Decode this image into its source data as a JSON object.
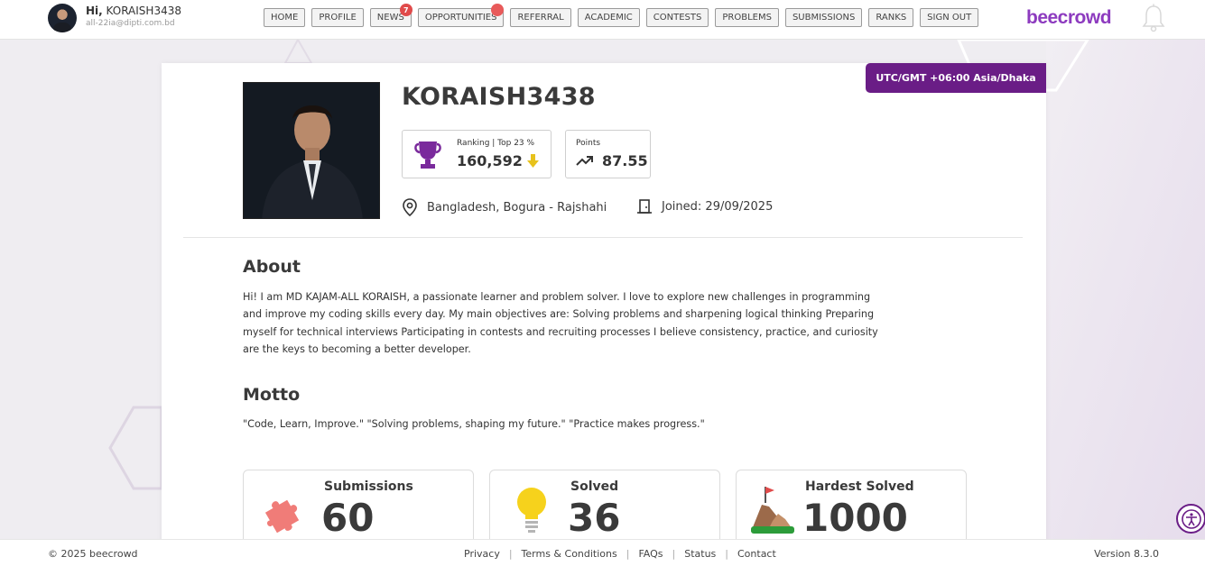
{
  "header": {
    "greeting_prefix": "Hi,",
    "username": "KORAISH3438",
    "email": "all-22ia@dipti.com.bd",
    "brand": "beecrowd",
    "nav": [
      {
        "label": "HOME"
      },
      {
        "label": "PROFILE"
      },
      {
        "label": "NEWS",
        "badge": "7"
      },
      {
        "label": "OPPORTUNITIES",
        "dot": true
      },
      {
        "label": "REFERRAL"
      },
      {
        "label": "ACADEMIC"
      },
      {
        "label": "CONTESTS"
      },
      {
        "label": "PROBLEMS"
      },
      {
        "label": "SUBMISSIONS"
      },
      {
        "label": "RANKS"
      },
      {
        "label": "SIGN OUT"
      }
    ],
    "accent_color": "#8d3bbf"
  },
  "profile": {
    "timezone": "UTC/GMT +06:00 Asia/Dhaka",
    "name": "KORAISH3438",
    "ranking_label": "Ranking | Top 23 %",
    "ranking_value": "160,592",
    "points_label": "Points",
    "points_value": "87.55",
    "location": "Bangladesh, Bogura - Rajshahi",
    "joined_label": "Joined:",
    "joined_date": "29/09/2025",
    "timezone_color": "#6a1d86"
  },
  "about": {
    "title": "About",
    "text": "Hi! I am MD KAJAM-ALL KORAISH, a passionate learner and problem solver. I love to explore new challenges in programming and improve my coding skills every day. My main objectives are: Solving problems and sharpening logical thinking Preparing myself for technical interviews Participating in contests and recruiting processes I believe consistency, practice, and curiosity are the keys to becoming a better developer."
  },
  "motto": {
    "title": "Motto",
    "text": "\"Code, Learn, Improve.\" \"Solving problems, shaping my future.\" \"Practice makes progress.\""
  },
  "stats": [
    {
      "label": "Submissions",
      "value": "60",
      "icon": "puzzle-icon"
    },
    {
      "label": "Solved",
      "value": "36",
      "icon": "lightbulb-icon"
    },
    {
      "label": "Hardest Solved",
      "value": "1000",
      "icon": "mountain-flag-icon"
    }
  ],
  "footer": {
    "copyright": "© 2025 beecrowd",
    "links": [
      "Privacy",
      "Terms & Conditions",
      "FAQs",
      "Status",
      "Contact"
    ],
    "version": "Version 8.3.0"
  }
}
